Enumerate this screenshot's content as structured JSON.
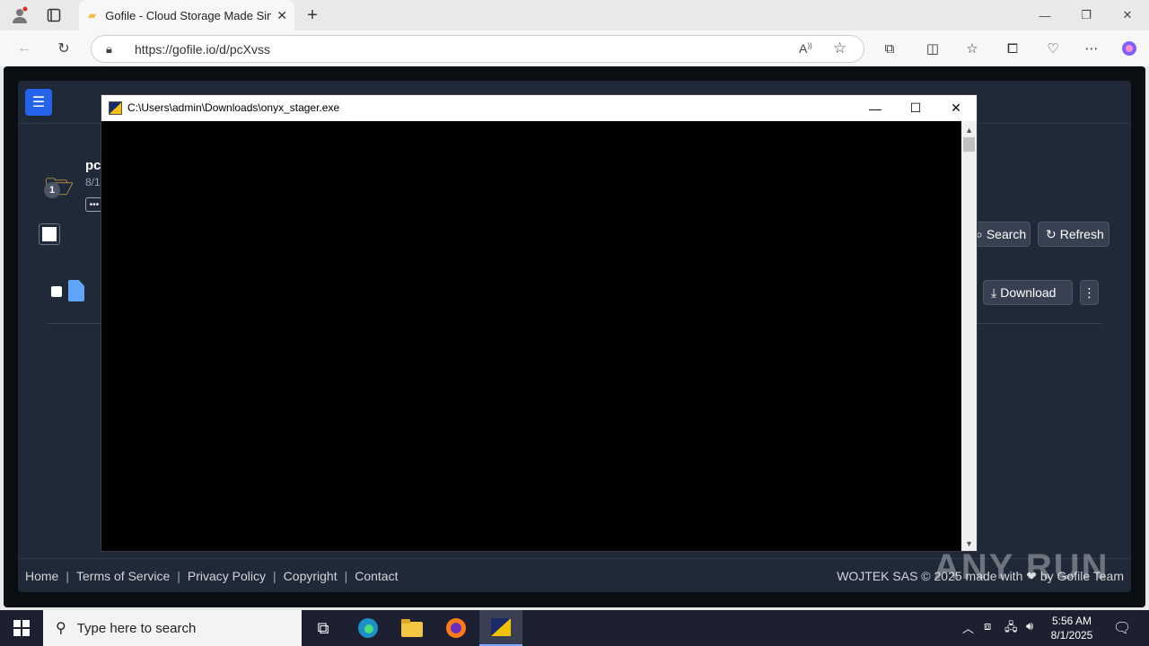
{
  "browser": {
    "tab_title": "Gofile - Cloud Storage Made Simple",
    "url": "https://gofile.io/d/pcXvss"
  },
  "page": {
    "folder_name": "pc",
    "folder_date": "8/1",
    "folder_badge": "1",
    "search_label": "Search",
    "refresh_label": "Refresh",
    "download_label": "Download",
    "footer": {
      "links": [
        "Home",
        "Terms of Service",
        "Privacy Policy",
        "Copyright",
        "Contact"
      ],
      "right": "WOJTEK SAS © 2025 made with ❤ by Gofile Team"
    }
  },
  "console": {
    "title": "C:\\Users\\admin\\Downloads\\onyx_stager.exe"
  },
  "watermark": "ANY RUN",
  "taskbar": {
    "search_placeholder": "Type here to search",
    "time": "5:56 AM",
    "date": "8/1/2025"
  },
  "colors": {
    "accent": "#2563eb",
    "page_bg": "#1f2937",
    "console_bg": "#000000"
  }
}
